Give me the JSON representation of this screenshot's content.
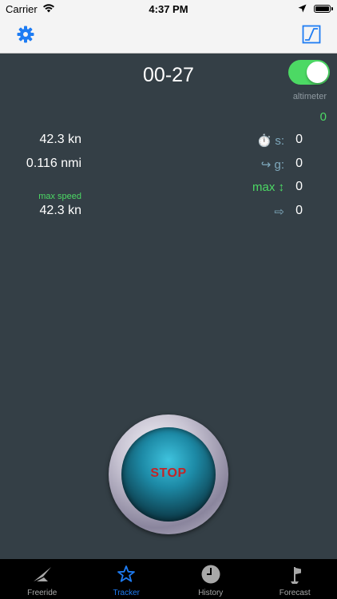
{
  "status_bar": {
    "carrier": "Carrier",
    "time": "4:37 PM",
    "wifi_icon": "wifi-icon",
    "location_icon": "location-arrow-icon",
    "battery_icon": "battery-icon"
  },
  "nav_bar": {
    "left_icon": "gear-icon",
    "right_icon": "chart-icon",
    "accent_color": "#1e7cf3"
  },
  "tracker": {
    "timer": "00-27",
    "altimeter_toggle_on": true,
    "altimeter_label": "altimeter",
    "altimeter_value": "0",
    "speed": "42.3 kn",
    "distance": "0.116 nmi",
    "max_speed_label": "max speed",
    "max_speed": "42.3 kn",
    "stats": [
      {
        "icon": "stopwatch-icon",
        "label": "⏱️ s:",
        "value": "0"
      },
      {
        "icon": "curved-arrow-icon",
        "label": "↪ g:",
        "value": "0"
      },
      {
        "icon": "up-down-arrow-icon",
        "label": "max ↕",
        "value": "0"
      },
      {
        "icon": "right-arrow-outline-icon",
        "label": "⇨",
        "value": "0"
      }
    ],
    "stop_label": "STOP"
  },
  "tabs": [
    {
      "label": "Freeride",
      "icon": "glider-icon",
      "active": false
    },
    {
      "label": "Tracker",
      "icon": "star-icon",
      "active": true
    },
    {
      "label": "History",
      "icon": "clock-icon",
      "active": false
    },
    {
      "label": "Forecast",
      "icon": "windsock-icon",
      "active": false
    }
  ],
  "colors": {
    "background": "#343f46",
    "green": "#4cd964",
    "stop_red": "#c32528",
    "tab_active": "#1e7cf3"
  }
}
